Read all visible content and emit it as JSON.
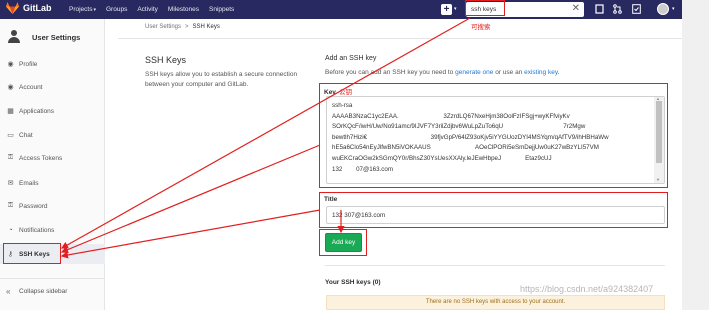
{
  "navbar": {
    "logo_text": "GitLab",
    "links": [
      "Projects",
      "Groups",
      "Activity",
      "Milestones",
      "Snippets"
    ],
    "projects_caret": "▾",
    "search_value": "ssh keys",
    "search_clear": "✕",
    "plus": "+"
  },
  "sidebar": {
    "title": "User Settings",
    "items": [
      {
        "label": "Profile",
        "icon": "profile-icon"
      },
      {
        "label": "Account",
        "icon": "account-icon"
      },
      {
        "label": "Applications",
        "icon": "applications-icon"
      },
      {
        "label": "Chat",
        "icon": "chat-icon"
      },
      {
        "label": "Access Tokens",
        "icon": "access-tokens-icon"
      },
      {
        "label": "Emails",
        "icon": "emails-icon"
      },
      {
        "label": "Password",
        "icon": "password-icon"
      },
      {
        "label": "Notifications",
        "icon": "notifications-icon"
      },
      {
        "label": "SSH Keys",
        "icon": "key-icon",
        "active": true
      }
    ],
    "collapse_label": "Collapse sidebar"
  },
  "breadcrumb": {
    "parent": "User Settings",
    "separator": ">",
    "current": "SSH Keys"
  },
  "left": {
    "title": "SSH Keys",
    "description": "SSH keys allow you to establish a secure connection between your computer and GitLab."
  },
  "form": {
    "section_title": "Add an SSH key",
    "before_prefix": "Before you can add an SSH key you need to ",
    "generate_link": "generate one",
    "middle": " or use an ",
    "existing_link": "existing key",
    "suffix": ".",
    "key_label": "Key",
    "key_annotation": "公钥",
    "key_value": "ssh-rsa\nAAAAB3NzaC1yc2EAA.                          3ZzrdLQ67NxeHjm38OolFzIFSgj+wyKFfviyKv\nSOrKQcF/iwH/Uw/No91amc/9IJVF7Y3rilZdjbv6WuLpZuTo6qU                                   7r2Mgw\nbewtlh7Hizi€                                     39fjvGpP/64lZ93oKjv5iYYGUozDYI4MSYqm/qAfTV9/ihHBHaWw\nhE5a6Clo54nEyJlfwBN5iVOKAAUS                          AOeClPORi5eSmDejjUw0uK27wBzYLI57VM\nwuEKCraOGw2kSGmQY0r/BhsZ30YsUesXXAly.leJEwHbpeJ              Etaz9cUJ\n132        07@163.com",
    "title_label": "Title",
    "title_value": "132      307@163.com",
    "add_button": "Add key",
    "your_keys_title": "Your SSH keys (0)",
    "no_keys_text": "There are no SSH keys with access to your account."
  },
  "annotations": {
    "search_hint": "可搜索",
    "watermark": "https://blog.csdn.net/a924382407"
  },
  "colors": {
    "navbar": "#292961",
    "accent_link": "#1f78d1",
    "button_green": "#1aaa55",
    "annotation_red": "#e02020"
  }
}
